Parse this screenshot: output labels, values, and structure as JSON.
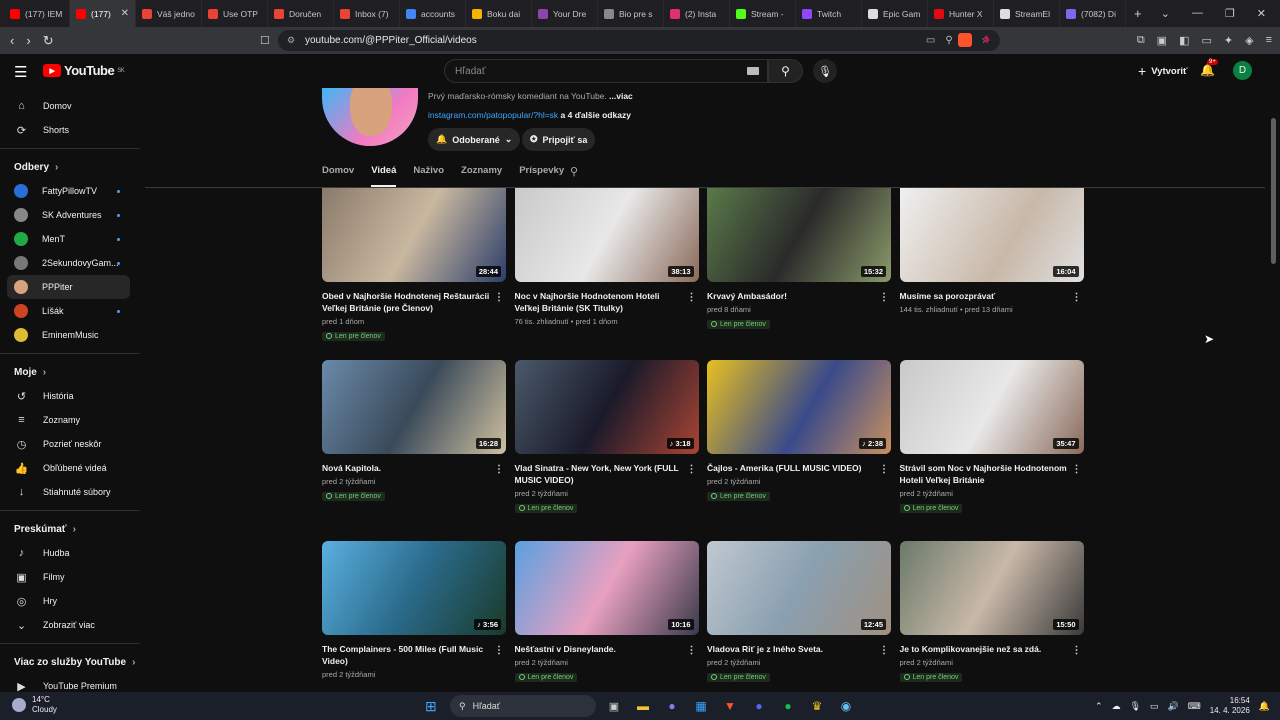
{
  "browser": {
    "tabs": [
      {
        "label": "(177) IEM",
        "color": "#ff0000"
      },
      {
        "label": "(177)",
        "color": "#ff0000",
        "active": true
      },
      {
        "label": "Váš jedno",
        "color": "#ea4335"
      },
      {
        "label": "Use OTP",
        "color": "#ea4335"
      },
      {
        "label": "Doručen",
        "color": "#ea4335"
      },
      {
        "label": "Inbox (7)",
        "color": "#ea4335"
      },
      {
        "label": "accounts",
        "color": "#4285f4"
      },
      {
        "label": "Boku dai",
        "color": "#f4b400"
      },
      {
        "label": "Your Dre",
        "color": "#8e44ad"
      },
      {
        "label": "Bio pre s",
        "color": "#888888"
      },
      {
        "label": "(2) Insta",
        "color": "#e1306c"
      },
      {
        "label": "Stream -",
        "color": "#53fc18"
      },
      {
        "label": "Twitch",
        "color": "#9146ff"
      },
      {
        "label": "Epic Gam",
        "color": "#dddddd"
      },
      {
        "label": "Hunter X",
        "color": "#e50914"
      },
      {
        "label": "StreamEl",
        "color": "#dddddd"
      },
      {
        "label": "(7082) Di",
        "color": "#7b68ee"
      }
    ],
    "url": "youtube.com/@PPPiter_Official/videos"
  },
  "header": {
    "logo_text": "YouTube",
    "logo_region": "SK",
    "search_placeholder": "Hľadať",
    "create_label": "Vytvoriť",
    "notif_count": "9+",
    "avatar_letter": "D"
  },
  "sidebar": {
    "main": [
      {
        "label": "Domov",
        "icon": "⌂"
      },
      {
        "label": "Shorts",
        "icon": "⟳"
      }
    ],
    "subs_title": "Odbery",
    "subs": [
      {
        "label": "FattyPillowTV",
        "color": "#2a6ed8",
        "dot": true
      },
      {
        "label": "SK Adventures",
        "color": "#888888",
        "dot": true
      },
      {
        "label": "MenT",
        "color": "#22aa44",
        "dot": true
      },
      {
        "label": "2SekundovyGam...",
        "color": "#777777",
        "dot": true
      },
      {
        "label": "PPPiter",
        "color": "#d9a27e",
        "dot": false,
        "active": true
      },
      {
        "label": "Líšák",
        "color": "#cc4422",
        "dot": true
      },
      {
        "label": "EminemMusic",
        "color": "#ddbb33",
        "dot": false
      }
    ],
    "you_title": "Moje",
    "you": [
      {
        "label": "História",
        "icon": "↺"
      },
      {
        "label": "Zoznamy",
        "icon": "≡"
      },
      {
        "label": "Pozrieť neskôr",
        "icon": "◷"
      },
      {
        "label": "Obľúbené videá",
        "icon": "👍"
      },
      {
        "label": "Stiahnuté súbory",
        "icon": "↓"
      }
    ],
    "explore_title": "Preskúmať",
    "explore": [
      {
        "label": "Hudba",
        "icon": "♪"
      },
      {
        "label": "Filmy",
        "icon": "▣"
      },
      {
        "label": "Hry",
        "icon": "◎"
      },
      {
        "label": "Zobraziť viac",
        "icon": "⌄"
      }
    ],
    "more_title": "Viac zo služby YouTube",
    "more": [
      {
        "label": "YouTube Premium",
        "icon": "▶"
      }
    ]
  },
  "channel": {
    "desc": "Prvý maďarsko-rómsky komediant na YouTube.",
    "desc_more": "...viac",
    "link": "instagram.com/patopopular/?hl=sk",
    "links_more": "a 4 ďalšie odkazy",
    "subscribe_label": "Odoberané",
    "join_label": "Pripojiť sa",
    "tabs": [
      "Domov",
      "Videá",
      "Naživo",
      "Zoznamy",
      "Príspevky"
    ],
    "active_tab": "Videá"
  },
  "videos": [
    {
      "title": "Obed v Najhoršie Hodnotenej Reštaurácii Veľkej Británie (pre Členov)",
      "meta": "pred 1 dňom",
      "duration": "28:44",
      "member": true,
      "bg": "linear-gradient(120deg,#8a7a6a,#c9b8a0 50%,#2c3e6a)"
    },
    {
      "title": "Noc v Najhoršie Hodnotenom Hoteli Veľkej Británie (SK Titulky)",
      "meta": "76 tis. zhliadnutí • pred 1 dňom",
      "duration": "38:13",
      "member": false,
      "bg": "linear-gradient(120deg,#c9c9c9,#e8e8e8 50%,#8a6a5a)"
    },
    {
      "title": "Krvavý Ambasádor!",
      "meta": "pred 8 dňami",
      "duration": "15:32",
      "member": true,
      "bg": "linear-gradient(120deg,#5a7a4a,#2a2a2a 50%,#8a9a6a)"
    },
    {
      "title": "Musíme sa porozprávať",
      "meta": "144 tis. zhliadnutí • pred 13 dňami",
      "duration": "16:04",
      "member": false,
      "bg": "linear-gradient(120deg,#f0f0f0,#c8b8a8 60%,#e0e0e0)"
    },
    {
      "title": "Nová Kapitola.",
      "meta": "pred 2 týždňami",
      "duration": "16:28",
      "member": true,
      "bg": "linear-gradient(120deg,#6a8aaa,#3a4a5a 50%,#cfc0a0)"
    },
    {
      "title": "Vlad Sinatra - New York, New York (FULL MUSIC VIDEO)",
      "meta": "pred 2 týždňami",
      "duration": "♪ 3:18",
      "member": true,
      "bg": "linear-gradient(120deg,#4a5a6a,#1a1a2a 50%,#aa4433)"
    },
    {
      "title": "Čajlos - Amerika (FULL MUSIC VIDEO)",
      "meta": "pred 2 týždňami",
      "duration": "♪ 2:38",
      "member": true,
      "bg": "linear-gradient(120deg,#e8c020,#3a4a8a 55%,#c89060)"
    },
    {
      "title": "Strávil som Noc v Najhoršie Hodnotenom Hoteli Veľkej Británie",
      "meta": "pred 2 týždňami",
      "duration": "35:47",
      "member": true,
      "bg": "linear-gradient(120deg,#c9c9c9,#e8e8e8 50%,#8a6a5a)"
    },
    {
      "title": "The Complainers - 500 Miles (Full Music Video)",
      "meta": "pred 2 týždňami",
      "duration": "♪ 3:56",
      "member": false,
      "bg": "linear-gradient(120deg,#5ab0e0,#2a6a8a 50%,#1a3a2a)"
    },
    {
      "title": "Nešťastní v Disneylande.",
      "meta": "pred 2 týždňami",
      "duration": "10:16",
      "member": true,
      "bg": "linear-gradient(120deg,#5aa0e0,#e8a0c0 50%,#3a3a4a)"
    },
    {
      "title": "Vladova Riť je z Iného Sveta.",
      "meta": "pred 2 týždňami",
      "duration": "12:45",
      "member": true,
      "bg": "linear-gradient(120deg,#c0c8d0,#8aa0b0 50%,#a09080)"
    },
    {
      "title": "Je to Komplikovanejšie než sa zdá.",
      "meta": "pred 2 týždňami",
      "duration": "15:50",
      "member": true,
      "bg": "linear-gradient(120deg,#6a7a6a,#c9b8a8 50%,#3a3a3a)"
    }
  ],
  "member_label": "Len pre členov",
  "taskbar": {
    "temp": "14°C",
    "weather": "Cloudy",
    "search_label": "Hľadať",
    "time": "16:54",
    "date": "14. 4. 2026"
  }
}
